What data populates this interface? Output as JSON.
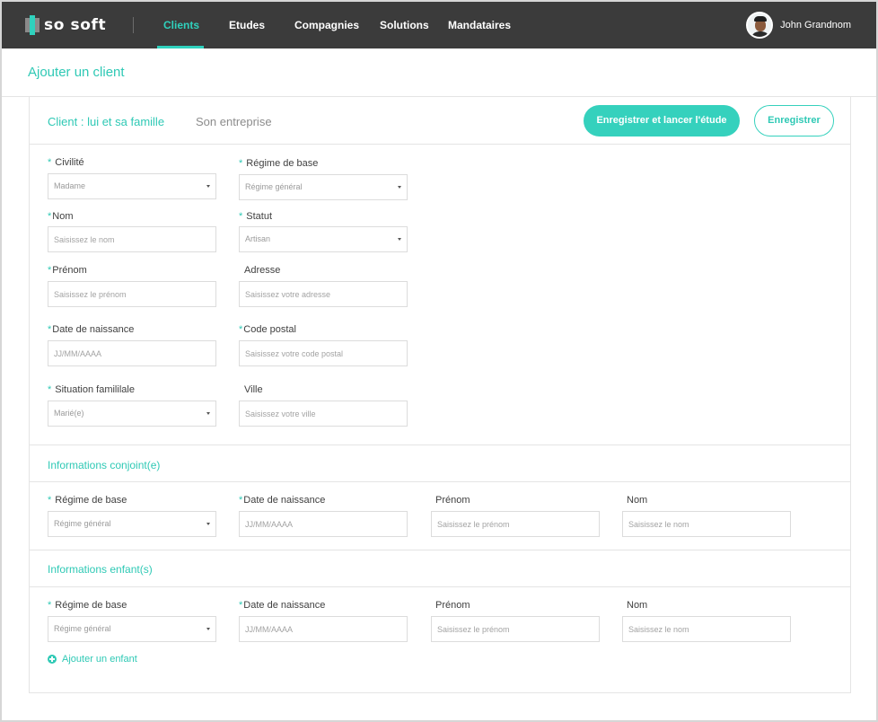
{
  "brand": {
    "name": "so soft"
  },
  "nav": {
    "items": [
      {
        "label": "Clients",
        "active": true
      },
      {
        "label": "Etudes",
        "active": false
      },
      {
        "label": "Compagnies",
        "active": false
      },
      {
        "label": "Solutions",
        "active": false
      },
      {
        "label": "Mandataires",
        "active": false
      }
    ],
    "user_name": "John Grandnom"
  },
  "page": {
    "title": "Ajouter un client"
  },
  "tabs": [
    {
      "label": "Client : lui et sa famille",
      "active": true
    },
    {
      "label": "Son entreprise",
      "active": false
    }
  ],
  "actions": {
    "save_and_start": "Enregistrer et lancer l'étude",
    "save": "Enregistrer"
  },
  "client": {
    "civilite": {
      "label": "Civilité",
      "value": "Madame"
    },
    "regime": {
      "label": "Régime de base",
      "value": "Régime général"
    },
    "nom": {
      "label": "Nom",
      "placeholder": "Saisissez le nom"
    },
    "statut": {
      "label": "Statut",
      "value": "Artisan"
    },
    "prenom": {
      "label": "Prénom",
      "placeholder": "Saisissez le prénom"
    },
    "adresse": {
      "label": "Adresse",
      "placeholder": "Saisissez votre adresse"
    },
    "naissance": {
      "label": "Date de naissance",
      "placeholder": "JJ/MM/AAAA"
    },
    "code_postal": {
      "label": "Code postal",
      "placeholder": "Saisissez votre code postal"
    },
    "situation": {
      "label": "Situation famililale",
      "value": "Marié(e)"
    },
    "ville": {
      "label": "Ville",
      "placeholder": "Saisissez votre ville"
    }
  },
  "conjoint": {
    "title": "Informations conjoint(e)",
    "regime": {
      "label": "Régime de base",
      "value": "Régime général"
    },
    "naissance": {
      "label": "Date de naissance",
      "placeholder": "JJ/MM/AAAA"
    },
    "prenom": {
      "label": "Prénom",
      "placeholder": "Saisissez le prénom"
    },
    "nom": {
      "label": "Nom",
      "placeholder": "Saisissez le nom"
    }
  },
  "enfants": {
    "title": "Informations enfant(s)",
    "regime": {
      "label": "Régime de base",
      "value": "Régime général"
    },
    "naissance": {
      "label": "Date de naissance",
      "placeholder": "JJ/MM/AAAA"
    },
    "prenom": {
      "label": "Prénom",
      "placeholder": "Saisissez le prénom"
    },
    "nom": {
      "label": "Nom",
      "placeholder": "Saisissez le nom"
    },
    "add_label": "Ajouter un enfant"
  },
  "colors": {
    "accent": "#2fc9b5",
    "topbar": "#3b3b3b"
  },
  "icons": {
    "add": "plus-circle-icon",
    "caret": "caret-down-icon",
    "avatar": "user-avatar"
  }
}
